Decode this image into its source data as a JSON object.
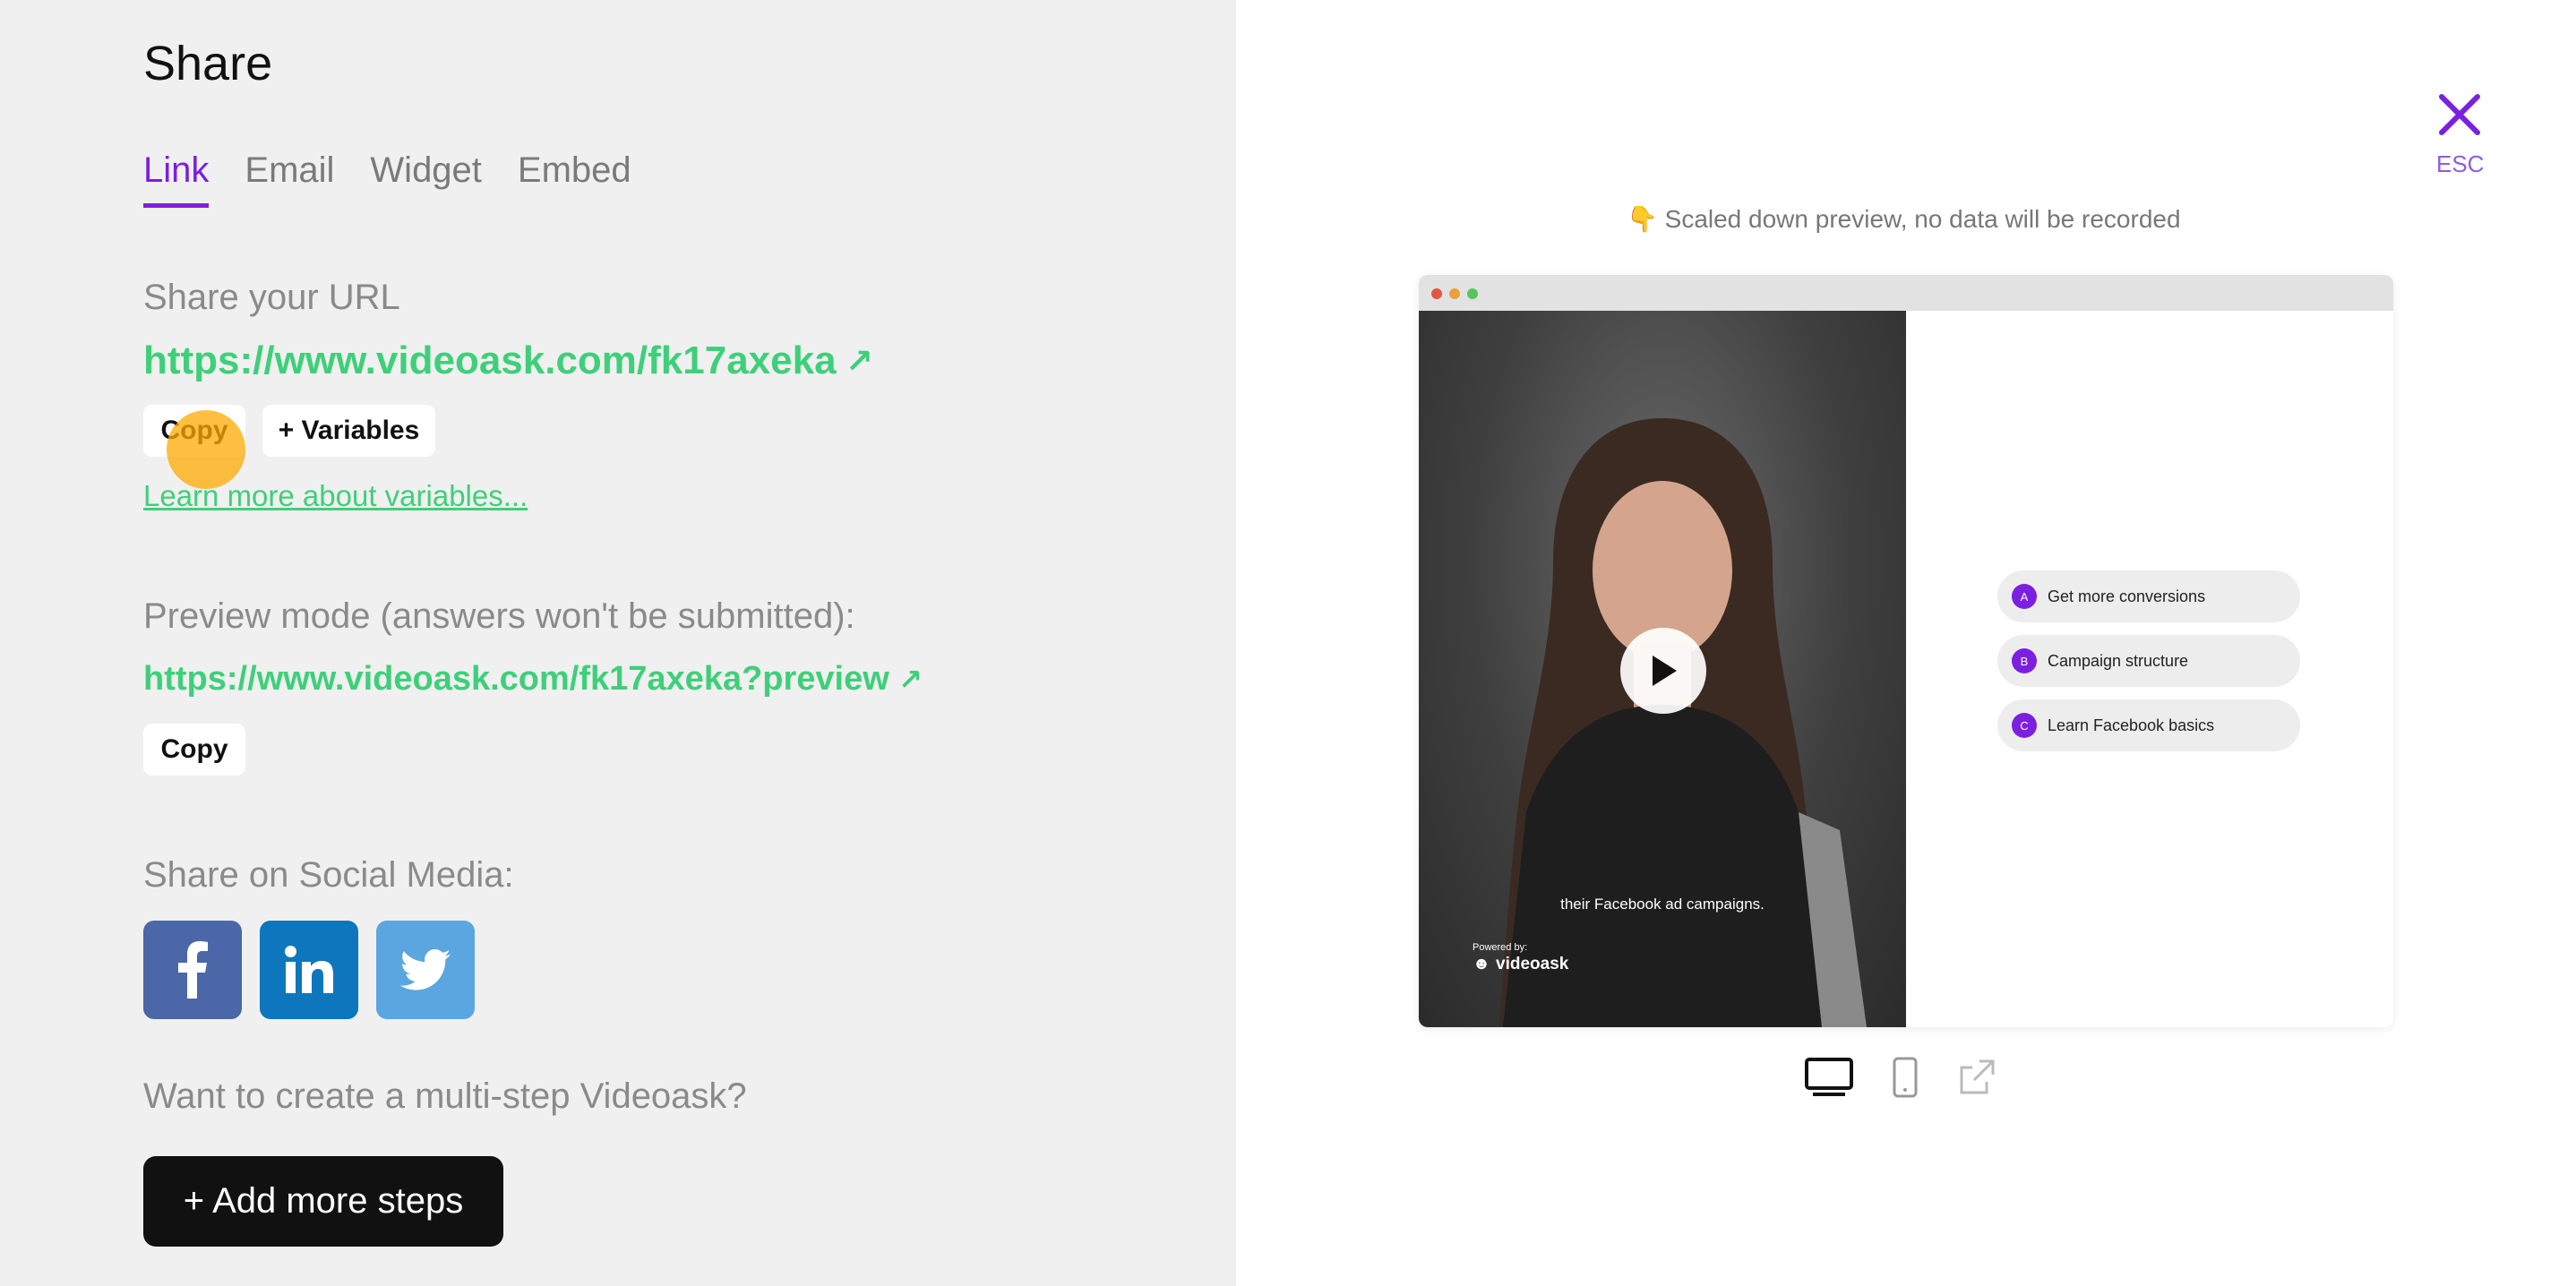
{
  "header": {
    "title": "Share"
  },
  "tabs": [
    {
      "label": "Link",
      "active": true
    },
    {
      "label": "Email",
      "active": false
    },
    {
      "label": "Widget",
      "active": false
    },
    {
      "label": "Embed",
      "active": false
    }
  ],
  "share_url": {
    "label": "Share your URL",
    "url": "https://www.videoask.com/fk17axeka",
    "copy_label": "Copy",
    "variables_label": "+ Variables",
    "learn_more": "Learn more about variables..."
  },
  "preview_mode": {
    "label": "Preview mode (answers won't be submitted):",
    "url": "https://www.videoask.com/fk17axeka?preview",
    "copy_label": "Copy"
  },
  "social": {
    "label": "Share on Social Media:",
    "items": [
      {
        "name": "facebook-icon",
        "color": "#4b67a8"
      },
      {
        "name": "linkedin-icon",
        "color": "#0e76bd"
      },
      {
        "name": "twitter-icon",
        "color": "#5ba6e0"
      }
    ]
  },
  "multistep": {
    "label": "Want to create a multi-step Videoask?",
    "button": "+ Add more steps"
  },
  "close": {
    "label": "ESC"
  },
  "preview": {
    "note": "👇 Scaled down preview, no data will be recorded",
    "subtitle": "their Facebook ad campaigns.",
    "powered_by": "Powered by:",
    "brand": "videoask",
    "options": [
      {
        "letter": "A",
        "label": "Get more conversions"
      },
      {
        "letter": "B",
        "label": "Campaign structure"
      },
      {
        "letter": "C",
        "label": "Learn Facebook basics"
      }
    ]
  },
  "devices": [
    "desktop-icon",
    "mobile-icon",
    "external-link-icon"
  ],
  "colors": {
    "accent": "#7b1fe0",
    "link_green": "#3fcf7a",
    "left_bg": "#f0f0f0"
  }
}
